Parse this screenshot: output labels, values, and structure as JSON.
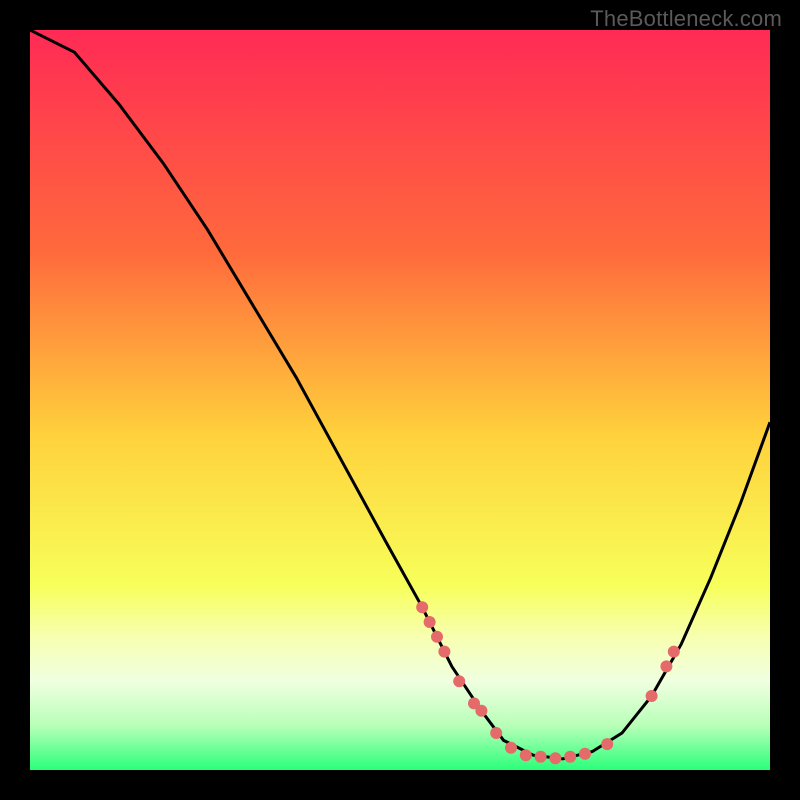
{
  "watermark": "TheBottleneck.com",
  "chart_data": {
    "type": "line",
    "title": "",
    "xlabel": "",
    "ylabel": "",
    "xlim": [
      0,
      100
    ],
    "ylim": [
      0,
      100
    ],
    "gradient_stops": [
      {
        "offset": 0,
        "color": "#ff2a55"
      },
      {
        "offset": 0.3,
        "color": "#ff6a3c"
      },
      {
        "offset": 0.55,
        "color": "#ffd23c"
      },
      {
        "offset": 0.75,
        "color": "#f7ff5a"
      },
      {
        "offset": 0.82,
        "color": "#f7ffb0"
      },
      {
        "offset": 0.88,
        "color": "#f0ffe0"
      },
      {
        "offset": 0.94,
        "color": "#b8ffb8"
      },
      {
        "offset": 1.0,
        "color": "#2aff7a"
      }
    ],
    "series": [
      {
        "name": "bottleneck-curve",
        "color": "#000000",
        "points": [
          {
            "x": 0,
            "y": 100
          },
          {
            "x": 6,
            "y": 97
          },
          {
            "x": 12,
            "y": 90
          },
          {
            "x": 18,
            "y": 82
          },
          {
            "x": 24,
            "y": 73
          },
          {
            "x": 30,
            "y": 63
          },
          {
            "x": 36,
            "y": 53
          },
          {
            "x": 42,
            "y": 42
          },
          {
            "x": 48,
            "y": 31
          },
          {
            "x": 53,
            "y": 22
          },
          {
            "x": 57,
            "y": 14
          },
          {
            "x": 61,
            "y": 8
          },
          {
            "x": 64,
            "y": 4
          },
          {
            "x": 68,
            "y": 2
          },
          {
            "x": 72,
            "y": 1.5
          },
          {
            "x": 76,
            "y": 2.5
          },
          {
            "x": 80,
            "y": 5
          },
          {
            "x": 84,
            "y": 10
          },
          {
            "x": 88,
            "y": 17
          },
          {
            "x": 92,
            "y": 26
          },
          {
            "x": 96,
            "y": 36
          },
          {
            "x": 100,
            "y": 47
          }
        ]
      }
    ],
    "markers": {
      "color": "#e56a6a",
      "radius": 6,
      "points": [
        {
          "x": 53,
          "y": 22
        },
        {
          "x": 54,
          "y": 20
        },
        {
          "x": 55,
          "y": 18
        },
        {
          "x": 56,
          "y": 16
        },
        {
          "x": 58,
          "y": 12
        },
        {
          "x": 60,
          "y": 9
        },
        {
          "x": 61,
          "y": 8
        },
        {
          "x": 63,
          "y": 5
        },
        {
          "x": 65,
          "y": 3
        },
        {
          "x": 67,
          "y": 2
        },
        {
          "x": 69,
          "y": 1.8
        },
        {
          "x": 71,
          "y": 1.6
        },
        {
          "x": 73,
          "y": 1.8
        },
        {
          "x": 75,
          "y": 2.2
        },
        {
          "x": 78,
          "y": 3.5
        },
        {
          "x": 84,
          "y": 10
        },
        {
          "x": 86,
          "y": 14
        },
        {
          "x": 87,
          "y": 16
        }
      ]
    }
  }
}
